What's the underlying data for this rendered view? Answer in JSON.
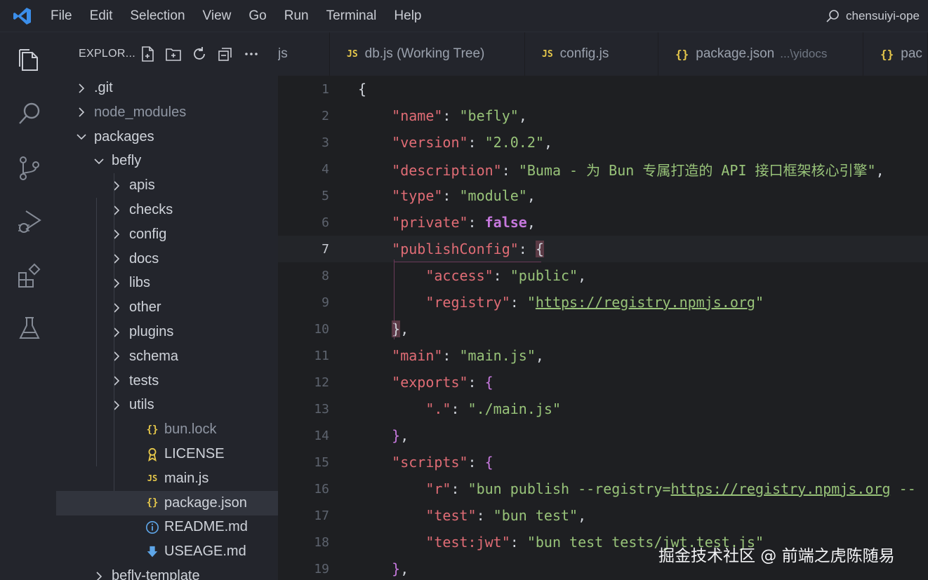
{
  "menu": [
    "File",
    "Edit",
    "Selection",
    "View",
    "Go",
    "Run",
    "Terminal",
    "Help"
  ],
  "search_text": "chensuiyi-ope",
  "activity_icons": [
    "explorer-icon",
    "search-icon",
    "source-control-icon",
    "run-debug-icon",
    "extensions-icon",
    "testing-icon"
  ],
  "sidebar": {
    "title": "EXPLOR...",
    "actions": [
      "new-file-icon",
      "new-folder-icon",
      "refresh-icon",
      "collapse-all-icon",
      "more-icon"
    ],
    "tree": [
      {
        "label": ".git",
        "type": "folder",
        "expanded": false,
        "dim": false
      },
      {
        "label": "node_modules",
        "type": "folder",
        "expanded": false,
        "dim": true
      },
      {
        "label": "packages",
        "type": "folder",
        "expanded": true,
        "dim": false
      },
      {
        "label": "befly",
        "type": "folder",
        "expanded": true,
        "dim": false
      },
      {
        "label": "apis",
        "type": "folder",
        "expanded": false,
        "dim": false
      },
      {
        "label": "checks",
        "type": "folder",
        "expanded": false,
        "dim": false
      },
      {
        "label": "config",
        "type": "folder",
        "expanded": false,
        "dim": false
      },
      {
        "label": "docs",
        "type": "folder",
        "expanded": false,
        "dim": false
      },
      {
        "label": "libs",
        "type": "folder",
        "expanded": false,
        "dim": false
      },
      {
        "label": "other",
        "type": "folder",
        "expanded": false,
        "dim": false
      },
      {
        "label": "plugins",
        "type": "folder",
        "expanded": false,
        "dim": false
      },
      {
        "label": "schema",
        "type": "folder",
        "expanded": false,
        "dim": false
      },
      {
        "label": "tests",
        "type": "folder",
        "expanded": false,
        "dim": false
      },
      {
        "label": "utils",
        "type": "folder",
        "expanded": false,
        "dim": false
      },
      {
        "label": "bun.lock",
        "type": "json",
        "dim": true
      },
      {
        "label": "LICENSE",
        "type": "license",
        "dim": false
      },
      {
        "label": "main.js",
        "type": "js",
        "dim": false
      },
      {
        "label": "package.json",
        "type": "json",
        "dim": false,
        "selected": true
      },
      {
        "label": "README.md",
        "type": "info",
        "dim": false
      },
      {
        "label": "USEAGE.md",
        "type": "download",
        "dim": false
      },
      {
        "label": "befly-template",
        "type": "folder",
        "expanded": false,
        "dim": false
      }
    ]
  },
  "tabs": [
    {
      "icon": "",
      "name": "js",
      "sub": ""
    },
    {
      "icon": "JS",
      "name": "db.js (Working Tree)",
      "sub": ""
    },
    {
      "icon": "JS",
      "name": "config.js",
      "sub": ""
    },
    {
      "icon": "{}",
      "name": "package.json",
      "sub": "...\\yidocs"
    },
    {
      "icon": "{}",
      "name": "pac",
      "sub": ""
    }
  ],
  "editor": {
    "current_line": 7,
    "lines": [
      {
        "n": "1",
        "parts": [
          [
            "p",
            "{"
          ]
        ]
      },
      {
        "n": "2",
        "parts": [
          [
            "p",
            "    "
          ],
          [
            "k",
            "\"name\""
          ],
          [
            "p",
            ": "
          ],
          [
            "s",
            "\"befly\""
          ],
          [
            "p",
            ","
          ]
        ]
      },
      {
        "n": "3",
        "parts": [
          [
            "p",
            "    "
          ],
          [
            "k",
            "\"version\""
          ],
          [
            "p",
            ": "
          ],
          [
            "s",
            "\"2.0.2\""
          ],
          [
            "p",
            ","
          ]
        ]
      },
      {
        "n": "4",
        "parts": [
          [
            "p",
            "    "
          ],
          [
            "k",
            "\"description\""
          ],
          [
            "p",
            ": "
          ],
          [
            "s",
            "\"Buma - 为 Bun 专属打造的 API 接口框架核心引擎\""
          ],
          [
            "p",
            ","
          ]
        ]
      },
      {
        "n": "5",
        "parts": [
          [
            "p",
            "    "
          ],
          [
            "k",
            "\"type\""
          ],
          [
            "p",
            ": "
          ],
          [
            "s",
            "\"module\""
          ],
          [
            "p",
            ","
          ]
        ]
      },
      {
        "n": "6",
        "parts": [
          [
            "p",
            "    "
          ],
          [
            "k",
            "\"private\""
          ],
          [
            "p",
            ": "
          ],
          [
            "kw",
            "false"
          ],
          [
            "p",
            ","
          ]
        ]
      },
      {
        "n": "7",
        "parts": [
          [
            "p",
            "    "
          ],
          [
            "k",
            "\"publishConfig\""
          ],
          [
            "p",
            ": "
          ],
          [
            "hl",
            "{"
          ]
        ]
      },
      {
        "n": "8",
        "parts": [
          [
            "p",
            "        "
          ],
          [
            "k",
            "\"access\""
          ],
          [
            "p",
            ": "
          ],
          [
            "s",
            "\"public\""
          ],
          [
            "p",
            ","
          ]
        ]
      },
      {
        "n": "9",
        "parts": [
          [
            "p",
            "        "
          ],
          [
            "k",
            "\"registry\""
          ],
          [
            "p",
            ": "
          ],
          [
            "s",
            "\""
          ],
          [
            "u",
            "https://registry.npmjs.org"
          ],
          [
            "s",
            "\""
          ]
        ]
      },
      {
        "n": "10",
        "parts": [
          [
            "p",
            "    "
          ],
          [
            "hl",
            "}"
          ],
          [
            "p",
            ","
          ]
        ]
      },
      {
        "n": "11",
        "parts": [
          [
            "p",
            "    "
          ],
          [
            "k",
            "\"main\""
          ],
          [
            "p",
            ": "
          ],
          [
            "s",
            "\"main.js\""
          ],
          [
            "p",
            ","
          ]
        ]
      },
      {
        "n": "12",
        "parts": [
          [
            "p",
            "    "
          ],
          [
            "k",
            "\"exports\""
          ],
          [
            "p",
            ": "
          ],
          [
            "b",
            "{"
          ]
        ]
      },
      {
        "n": "13",
        "parts": [
          [
            "p",
            "        "
          ],
          [
            "k",
            "\".\""
          ],
          [
            "p",
            ": "
          ],
          [
            "s",
            "\"./main.js\""
          ]
        ]
      },
      {
        "n": "14",
        "parts": [
          [
            "p",
            "    "
          ],
          [
            "b",
            "}"
          ],
          [
            "p",
            ","
          ]
        ]
      },
      {
        "n": "15",
        "parts": [
          [
            "p",
            "    "
          ],
          [
            "k",
            "\"scripts\""
          ],
          [
            "p",
            ": "
          ],
          [
            "b",
            "{"
          ]
        ]
      },
      {
        "n": "16",
        "parts": [
          [
            "p",
            "        "
          ],
          [
            "k",
            "\"r\""
          ],
          [
            "p",
            ": "
          ],
          [
            "s",
            "\"bun publish --registry="
          ],
          [
            "u",
            "https://registry.npmjs.org"
          ],
          [
            "s",
            " --"
          ]
        ]
      },
      {
        "n": "17",
        "parts": [
          [
            "p",
            "        "
          ],
          [
            "k",
            "\"test\""
          ],
          [
            "p",
            ": "
          ],
          [
            "s",
            "\"bun test\""
          ],
          [
            "p",
            ","
          ]
        ]
      },
      {
        "n": "18",
        "parts": [
          [
            "p",
            "        "
          ],
          [
            "k",
            "\"test:jwt\""
          ],
          [
            "p",
            ": "
          ],
          [
            "s",
            "\"bun test tests/jwt.test.js\""
          ]
        ]
      },
      {
        "n": "19",
        "parts": [
          [
            "p",
            "    "
          ],
          [
            "b",
            "}"
          ],
          [
            "p",
            ","
          ]
        ]
      }
    ]
  },
  "watermark": "掘金技术社区 @ 前端之虎陈随易"
}
